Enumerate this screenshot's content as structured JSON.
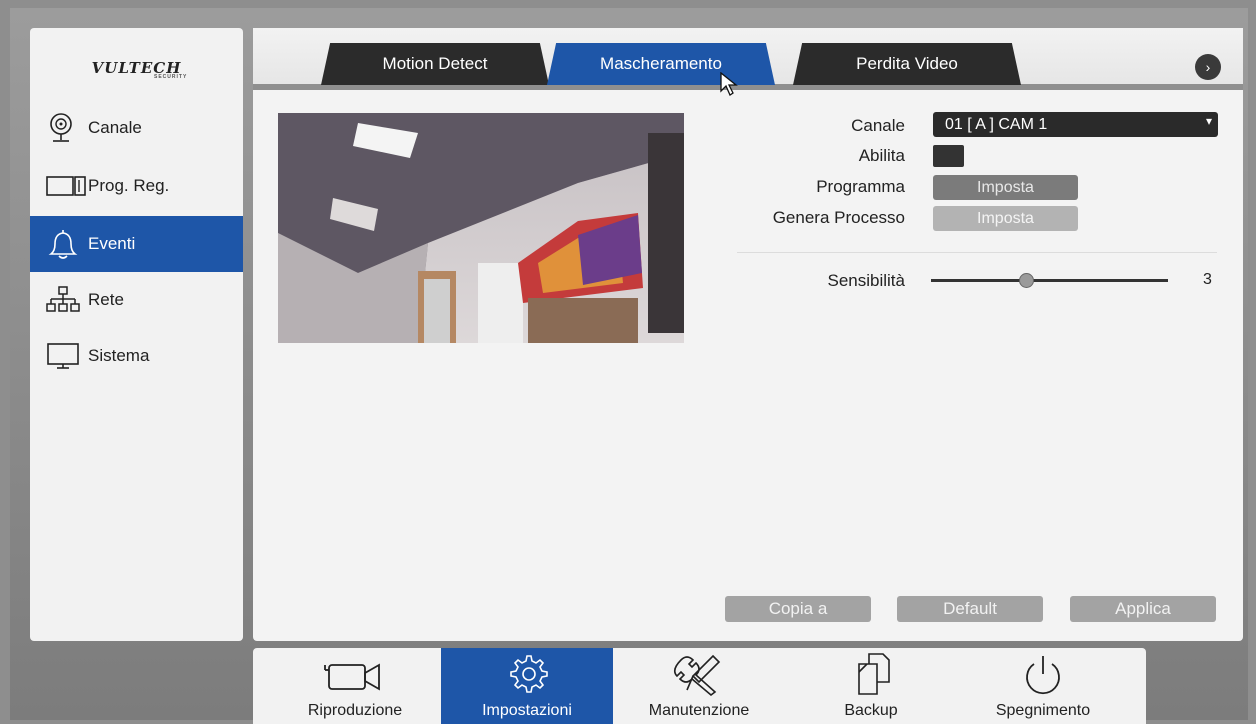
{
  "brand": {
    "logo_text": "VULTECH",
    "logo_sub": "SECURITY"
  },
  "sidebar": {
    "items": [
      {
        "label": "Canale",
        "icon": "webcam-icon"
      },
      {
        "label": "Prog. Reg.",
        "icon": "hdd-icon"
      },
      {
        "label": "Eventi",
        "icon": "bell-icon",
        "active": true
      },
      {
        "label": "Rete",
        "icon": "network-icon"
      },
      {
        "label": "Sistema",
        "icon": "monitor-icon"
      }
    ]
  },
  "tabs": [
    {
      "label": "Motion Detect"
    },
    {
      "label": "Mascheramento",
      "active": true
    },
    {
      "label": "Perdita Video"
    }
  ],
  "form": {
    "canale_label": "Canale",
    "canale_value": "01 [ A ] CAM 1",
    "abilita_label": "Abilita",
    "programma_label": "Programma",
    "programma_button": "Imposta",
    "genera_label": "Genera Processo",
    "genera_button": "Imposta",
    "sensibilita_label": "Sensibilità",
    "sensibilita_value": "3",
    "sensibilita_fraction": 0.4
  },
  "actions": {
    "copia": "Copia a",
    "default": "Default",
    "applica": "Applica"
  },
  "dock": [
    {
      "label": "Riproduzione",
      "icon": "camera-icon"
    },
    {
      "label": "Impostazioni",
      "icon": "gear-icon",
      "active": true
    },
    {
      "label": "Manutenzione",
      "icon": "tools-icon"
    },
    {
      "label": "Backup",
      "icon": "copy-icon"
    },
    {
      "label": "Spegnimento",
      "icon": "power-icon"
    }
  ],
  "colors": {
    "accent": "#1e56a8",
    "dark": "#2b2b2b",
    "panel": "#f3f3f3"
  }
}
